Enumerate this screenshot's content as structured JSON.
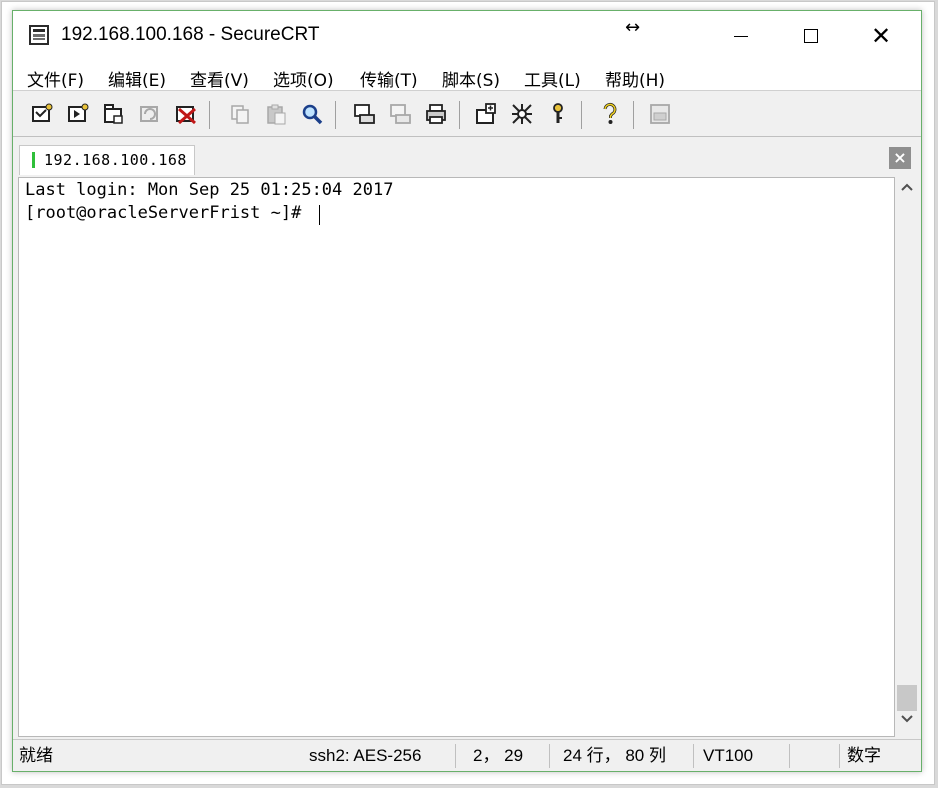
{
  "window": {
    "title": "192.168.100.168 - SecureCRT",
    "resize_glyph": "↔",
    "close_glyph": "✕"
  },
  "menu": [
    {
      "label": "文件(F)"
    },
    {
      "label": "编辑(E)"
    },
    {
      "label": "查看(V)"
    },
    {
      "label": "选项(O)"
    },
    {
      "label": "传输(T)"
    },
    {
      "label": "脚本(S)"
    },
    {
      "label": "工具(L)"
    },
    {
      "label": "帮助(H)"
    }
  ],
  "toolbar": {
    "icons": [
      "connect-icon",
      "quick-connect-icon",
      "connect-in-tab-icon",
      "reconnect-icon",
      "disconnect-icon",
      "copy-icon",
      "paste-icon",
      "find-icon",
      "print-screen-icon",
      "print-selection-icon",
      "print-icon",
      "session-options-icon",
      "global-options-icon",
      "keymap-icon",
      "help-icon",
      "sftp-icon"
    ]
  },
  "tab": {
    "label": "192.168.100.168",
    "status_color": "#2fbf3a",
    "close_glyph": "×"
  },
  "terminal": {
    "lines": [
      "Last login: Mon Sep 25 01:25:04 2017",
      "[root@oracleServerFrist ~]#"
    ]
  },
  "status": {
    "ready": "就绪",
    "cipher": "ssh2: AES-256",
    "cursor_pos": "2，  29",
    "size": "24 行， 80 列",
    "emulation": "VT100",
    "numlock": "数字"
  },
  "colors": {
    "window_border": "#68b06a",
    "background": "#f0f0f0"
  }
}
